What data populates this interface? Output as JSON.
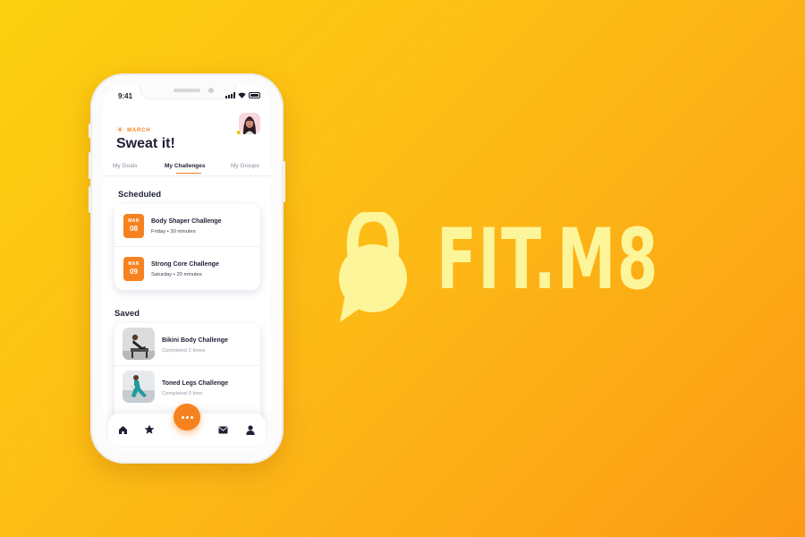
{
  "status_bar": {
    "time": "9:41"
  },
  "header": {
    "month": "MARCH",
    "title": "Sweat it!"
  },
  "tabs": [
    {
      "label": "My Goals",
      "active": false
    },
    {
      "label": "My Challenges",
      "active": true
    },
    {
      "label": "My Groups",
      "active": false
    }
  ],
  "scheduled": {
    "title": "Scheduled",
    "items": [
      {
        "month": "MAR",
        "day": "08",
        "name": "Body Shaper Challenge",
        "detail": "Friday • 30 minutes"
      },
      {
        "month": "MAR",
        "day": "09",
        "name": "Strong Core Challenge",
        "detail": "Saturday • 20 minutes"
      }
    ]
  },
  "saved": {
    "title": "Saved",
    "items": [
      {
        "name": "Bikini Body Challenge",
        "detail": "Completed 2 times"
      },
      {
        "name": "Toned Legs Challenge",
        "detail": "Completed 0 time"
      }
    ]
  },
  "bottom_nav": {
    "items": [
      {
        "icon": "home-icon"
      },
      {
        "icon": "star-icon"
      },
      {
        "icon": "more-icon"
      },
      {
        "icon": "mail-icon"
      },
      {
        "icon": "profile-icon"
      }
    ]
  },
  "brand": {
    "name": "FIT.M8",
    "color": "#fdf59a"
  },
  "colors": {
    "accent": "#f6821f",
    "background_from": "#fcd00f",
    "background_to": "#fb9a14"
  }
}
